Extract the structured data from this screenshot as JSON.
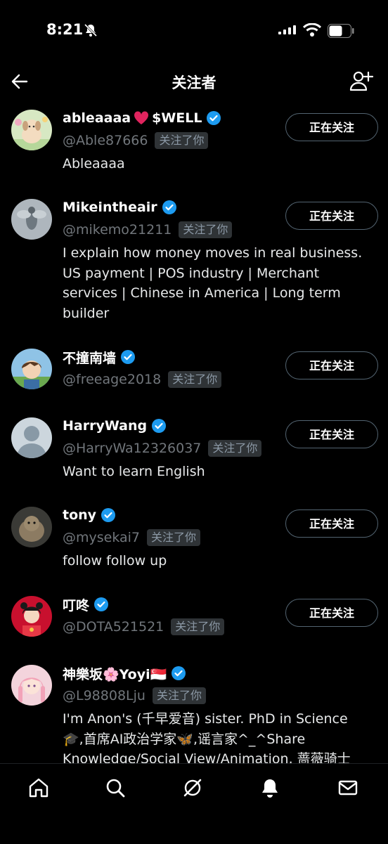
{
  "status_bar": {
    "time": "8:21",
    "battery": "57"
  },
  "header": {
    "title": "关注者"
  },
  "follow_button_label": "正在关注",
  "follows_you_label": "关注了你",
  "users": [
    {
      "name": "ableaaaa",
      "name_suffix": "$WELL",
      "handle": "@Able87666",
      "bio": "Ableaaaa"
    },
    {
      "name": "Mikeintheair",
      "handle": "@mikemo21211",
      "bio": "I explain how money moves in real business. US payment | POS industry | Merchant services | Chinese in America | Long term builder"
    },
    {
      "name": "不撞南墙",
      "handle": "@freeage2018",
      "bio": ""
    },
    {
      "name": "HarryWang",
      "handle": "@HarryWa12326037",
      "bio": "Want to learn English"
    },
    {
      "name": "tony",
      "handle": "@mysekai7",
      "bio": "follow follow up"
    },
    {
      "name": "叮咚",
      "handle": "@DOTA521521",
      "bio": ""
    },
    {
      "name": "神樂坂🌸Yoyi🇸🇬",
      "handle": "@L98808Lju",
      "bio": "I'm Anon's (千早爱音) sister. PhD in Science 🎓,首席AI政治学家🦋,谣言家^_^Share Knowledge/Social View/Animation. 蔷薇骑士"
    }
  ],
  "nav": [
    "home-icon",
    "search-icon",
    "grok-icon",
    "notifications-icon",
    "messages-icon"
  ],
  "colors": {
    "verified": "#1d9bf0",
    "background": "#000000",
    "muted": "#71767b"
  }
}
